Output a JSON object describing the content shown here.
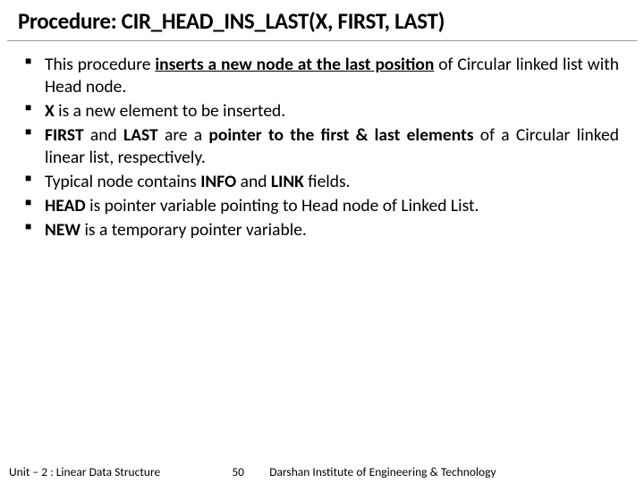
{
  "title": "Procedure: CIR_HEAD_INS_LAST(X, FIRST, LAST)",
  "bullets": [
    {
      "pre": "This procedure ",
      "bold_u": "inserts a new node at the last position",
      "post": " of Circular linked list with Head node."
    },
    {
      "bold1": "X",
      "post": " is a new element to be inserted."
    },
    {
      "bold1": "FIRST",
      "mid1": " and ",
      "bold2": "LAST",
      "mid2": " are a ",
      "bold3": "pointer to the first & last elements",
      "post": " of a Circular linked linear list, respectively."
    },
    {
      "pre": "Typical node contains ",
      "bold1": "INFO",
      "mid1": " and ",
      "bold2": "LINK",
      "post": " fields."
    },
    {
      "bold1": "HEAD",
      "post": " is pointer variable pointing to Head node of Linked List."
    },
    {
      "bold1": "NEW",
      "post": " is a temporary pointer variable."
    }
  ],
  "footer": {
    "left": "Unit – 2 : Linear Data Structure",
    "page": "50",
    "right": "Darshan Institute of Engineering & Technology"
  }
}
